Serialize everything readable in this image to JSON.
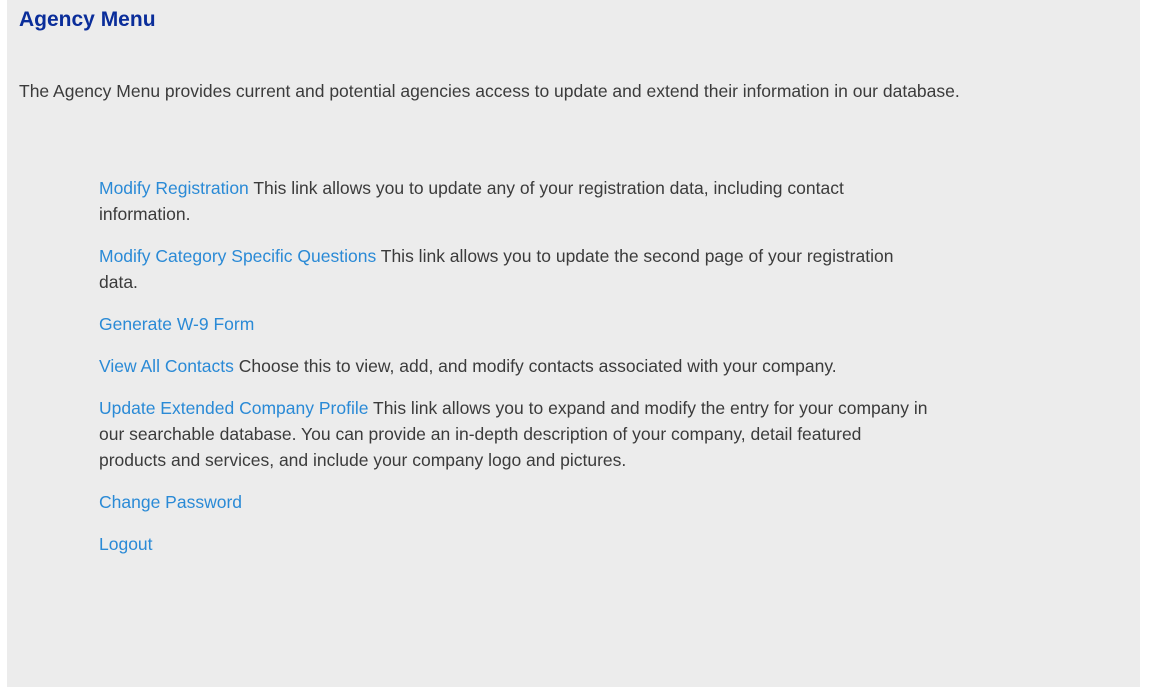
{
  "page": {
    "title": "Agency Menu",
    "intro": "The Agency Menu provides current and potential agencies access to update and extend their information in our database."
  },
  "menu": {
    "items": [
      {
        "link": "Modify Registration",
        "description": " This link allows you to update any of your registration data, including contact information."
      },
      {
        "link": "Modify Category Specific Questions",
        "description": " This link allows you to update the second page of your registration data."
      },
      {
        "link": "Generate W-9 Form",
        "description": ""
      },
      {
        "link": "View All Contacts",
        "description": " Choose this to view, add, and modify contacts associated with your company."
      },
      {
        "link": "Update Extended Company Profile",
        "description": "  This link allows you to expand and modify the entry for your company in our searchable database. You can provide an in-depth description of your company, detail featured products and services, and include your company logo and pictures."
      },
      {
        "link": "Change Password",
        "description": ""
      },
      {
        "link": "Logout",
        "description": ""
      }
    ]
  },
  "colors": {
    "panel_background": "#ececec",
    "title": "#0a2d9a",
    "link": "#2a8ad6",
    "body_text": "#3b3b3b"
  }
}
